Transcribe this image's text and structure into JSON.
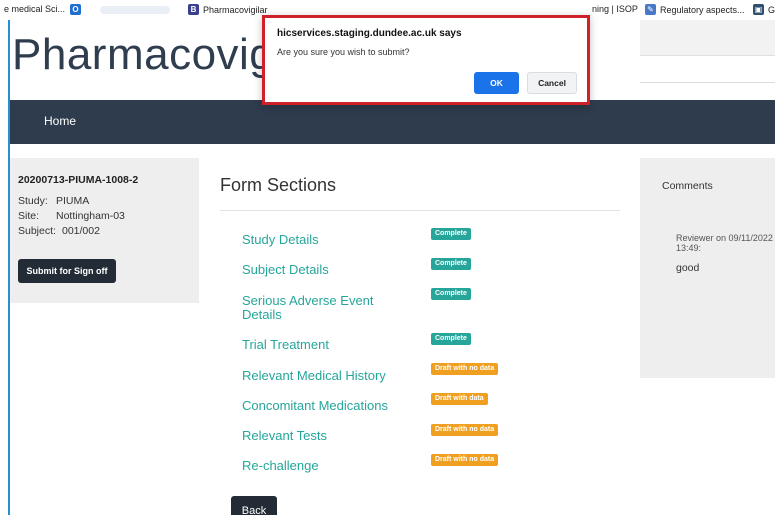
{
  "bookmarks": [
    {
      "label": "e medical Sci...",
      "icon": "none"
    },
    {
      "label": "",
      "icon": "office-icon",
      "icon_color": "#1f6fd0",
      "icon_glyph": "O"
    },
    {
      "label": "Pharmacovigilar",
      "icon": "b-icon",
      "icon_color": "#3b3f8f",
      "icon_glyph": "B"
    },
    {
      "label": "ning | ISOP",
      "icon": "none"
    },
    {
      "label": "Regulatory aspects...",
      "icon": "leaf-icon",
      "icon_color": "#4a78c8",
      "icon_glyph": "✎"
    },
    {
      "label": "Gi",
      "icon": "bookmark-icon",
      "icon_color": "#2f4f6f",
      "icon_glyph": "▣"
    }
  ],
  "header": {
    "title": "Pharmacovigi"
  },
  "nav": {
    "home": "Home"
  },
  "record": {
    "id": "20200713-PIUMA-1008-2",
    "study_label": "Study:",
    "study": "PIUMA",
    "site_label": "Site:",
    "site": "Nottingham-03",
    "subject_label": "Subject:",
    "subject": "001/002",
    "submit_label": "Submit for Sign off"
  },
  "form": {
    "title": "Form Sections",
    "sections": [
      {
        "label": "Study Details",
        "status": "Complete",
        "kind": "complete"
      },
      {
        "label": "Subject Details",
        "status": "Complete",
        "kind": "complete"
      },
      {
        "label": "Serious Adverse Event Details",
        "status": "Complete",
        "kind": "complete"
      },
      {
        "label": "Trial Treatment",
        "status": "Complete",
        "kind": "complete"
      },
      {
        "label": "Relevant Medical History",
        "status": "Draft with no data",
        "kind": "draft"
      },
      {
        "label": "Concomitant Medications",
        "status": "Draft with data",
        "kind": "draft"
      },
      {
        "label": "Relevant Tests",
        "status": "Draft with no data",
        "kind": "draft"
      },
      {
        "label": "Re-challenge",
        "status": "Draft with no data",
        "kind": "draft"
      }
    ],
    "back_label": "Back"
  },
  "comments": {
    "title": "Comments",
    "entry_meta": "Reviewer on 09/11/2022 13:49:",
    "entry_text": "good"
  },
  "dialog": {
    "host": "hicservices.staging.dundee.ac.uk says",
    "message": "Are you sure you wish to submit?",
    "ok_label": "OK",
    "cancel_label": "Cancel"
  },
  "colors": {
    "accent_teal": "#26a69a",
    "draft_orange": "#f0a020",
    "navbar": "#2f3c4d",
    "dialog_highlight": "#d0202a",
    "ok_blue": "#1a73e8"
  }
}
